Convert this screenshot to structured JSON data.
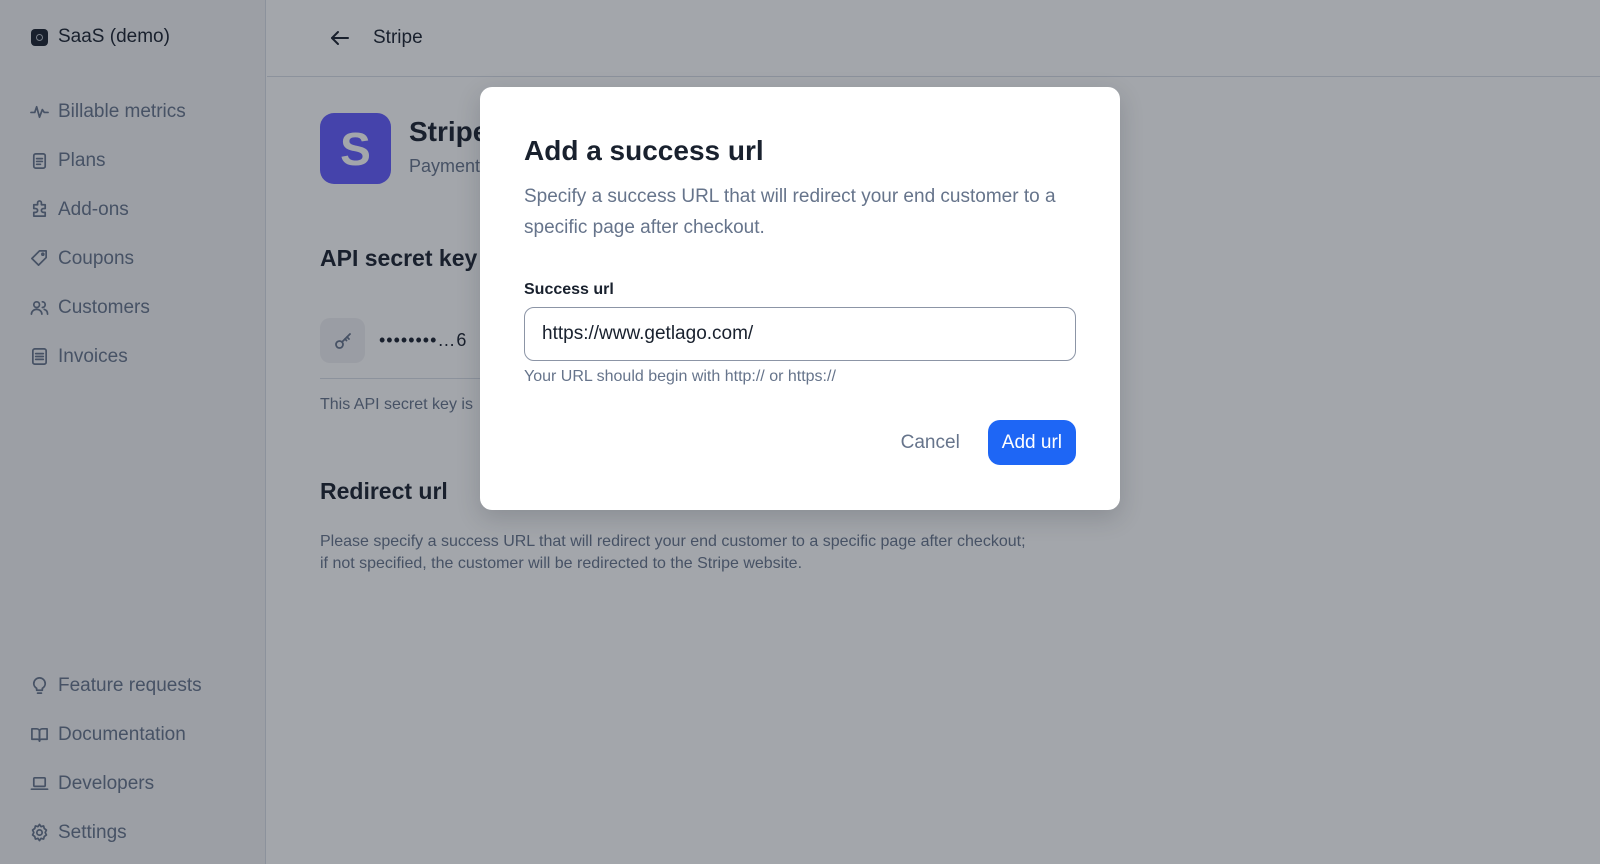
{
  "sidebar": {
    "org_name": "SaaS (demo)",
    "top_items": [
      {
        "label": "Billable metrics",
        "icon": "pulse-icon"
      },
      {
        "label": "Plans",
        "icon": "clipboard-icon"
      },
      {
        "label": "Add-ons",
        "icon": "puzzle-icon"
      },
      {
        "label": "Coupons",
        "icon": "tag-icon"
      },
      {
        "label": "Customers",
        "icon": "users-icon"
      },
      {
        "label": "Invoices",
        "icon": "receipt-icon"
      }
    ],
    "bottom_items": [
      {
        "label": "Feature requests",
        "icon": "lightbulb-icon"
      },
      {
        "label": "Documentation",
        "icon": "book-icon"
      },
      {
        "label": "Developers",
        "icon": "laptop-icon"
      },
      {
        "label": "Settings",
        "icon": "gear-icon"
      }
    ]
  },
  "header": {
    "title": "Stripe"
  },
  "integration": {
    "logo_letter": "S",
    "name": "Stripe",
    "subtitle": "Payment"
  },
  "api_key": {
    "title": "API secret key",
    "masked_value": "••••••••…6",
    "note": "This API secret key is"
  },
  "redirect": {
    "title": "Redirect url",
    "description_line1": "Please specify a success URL that will redirect your end customer to a specific page after checkout;",
    "description_line2": "if not specified, the customer will be redirected to the Stripe website."
  },
  "dialog": {
    "title": "Add a success url",
    "description": "Specify a success URL that will redirect your end customer to a specific page after checkout.",
    "field_label": "Success url",
    "field_value": "https://www.getlago.com/",
    "helper_text": "Your URL should begin with http:// or https://",
    "cancel_label": "Cancel",
    "submit_label": "Add url"
  },
  "colors": {
    "primary": "#1e66f5",
    "stripe_brand": "#635bff",
    "text": "#19212e",
    "muted": "#66748b"
  }
}
